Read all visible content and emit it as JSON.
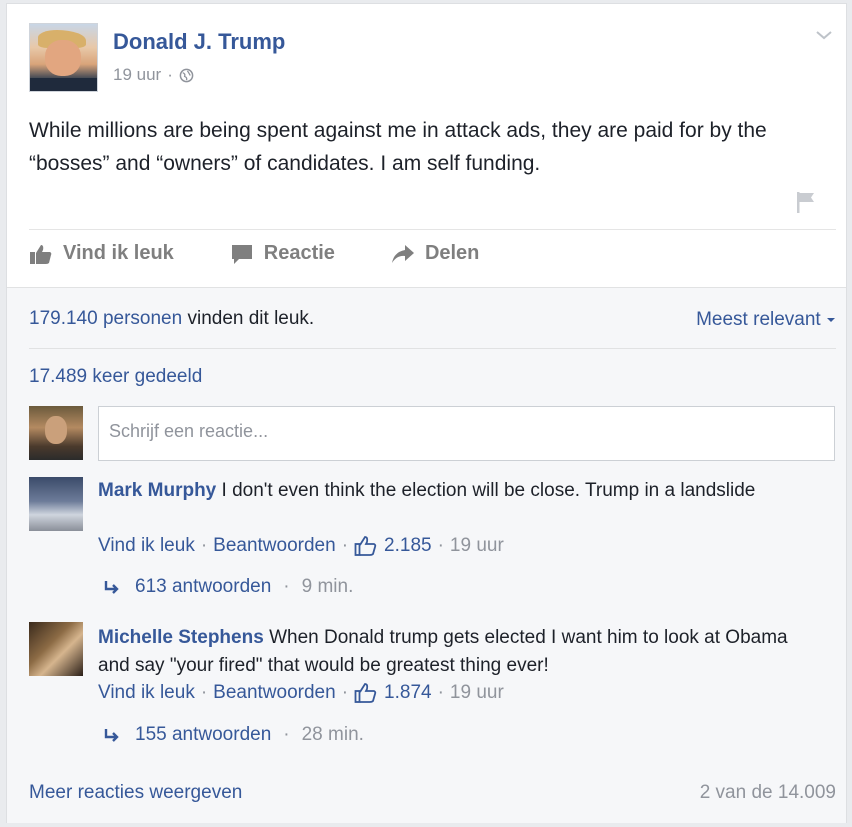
{
  "post": {
    "author": "Donald J. Trump",
    "time": "19 uur",
    "separator": "·",
    "text": "While millions are being spent against me in attack ads, they are paid for by the “bosses” and “owners” of candidates. I am self funding."
  },
  "actions": {
    "like": "Vind ik leuk",
    "comment": "Reactie",
    "share": "Delen"
  },
  "stats": {
    "likes_count": "179.140 personen",
    "likes_suffix": "vinden dit leuk.",
    "sort_label": "Meest relevant",
    "shares": "17.489 keer gedeeld"
  },
  "composer": {
    "placeholder": "Schrijf een reactie..."
  },
  "comments": [
    {
      "name": "Mark Murphy",
      "text": "I don't even think the election will be close. Trump in a landslide",
      "like": "Vind ik leuk",
      "reply": "Beantwoorden",
      "likes": "2.185",
      "time": "19 uur",
      "replies_count": "613 antwoorden",
      "replies_time": "9 min."
    },
    {
      "name": "Michelle Stephens",
      "text": "When Donald trump gets elected I want him to look at Obama and say \"your fired\" that would be greatest thing ever!",
      "like": "Vind ik leuk",
      "reply": "Beantwoorden",
      "likes": "1.874",
      "time": "19 uur",
      "replies_count": "155 antwoorden",
      "replies_time": "28 min."
    }
  ],
  "footer": {
    "more": "Meer reacties weergeven",
    "count": "2 van de 14.009"
  },
  "icons": [
    "globe-icon",
    "chevron-down-icon",
    "flag-icon",
    "like-icon",
    "comment-icon",
    "share-icon",
    "reply-arrow-icon",
    "thumbs-up-icon"
  ],
  "colors": {
    "link": "#365899",
    "muted": "#90949c",
    "text": "#1d2129"
  }
}
